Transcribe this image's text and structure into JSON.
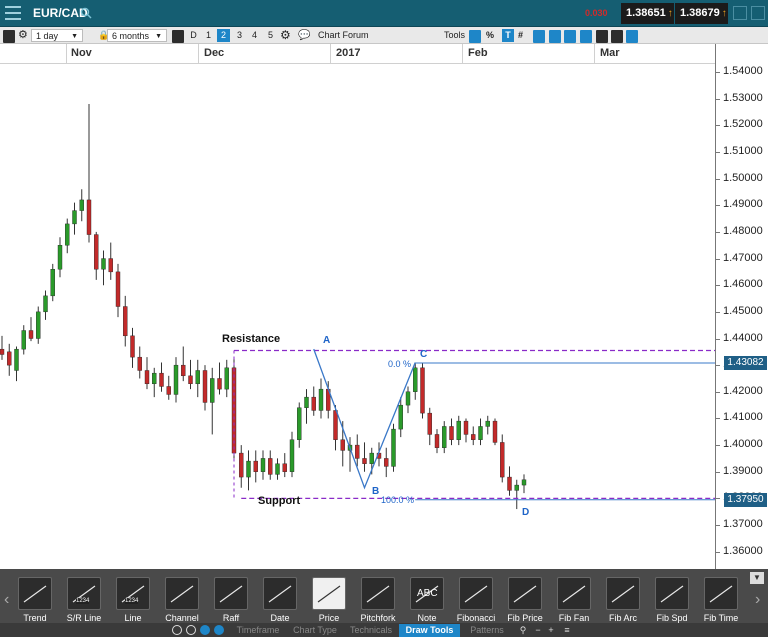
{
  "header": {
    "symbol": "EUR/CAD",
    "spread": "0.030",
    "bid": "1.38651",
    "ask": "1.38679",
    "bid_arrow": "↑",
    "ask_arrow": "↑"
  },
  "toolbar": {
    "interval": "1 day",
    "range": "6 months",
    "layouts": [
      "D",
      "1",
      "2",
      "3",
      "4",
      "5"
    ],
    "active_layout": "2",
    "chart_forum": "Chart Forum",
    "tools": "Tools",
    "percent": "%",
    "text_tool": "T"
  },
  "timeline": {
    "months": [
      "Nov",
      "Dec",
      "2017",
      "Feb",
      "Mar"
    ]
  },
  "yaxis": {
    "ticks": [
      "1.54000",
      "1.53000",
      "1.52000",
      "1.51000",
      "1.50000",
      "1.49000",
      "1.48000",
      "1.47000",
      "1.46000",
      "1.45000",
      "1.44000",
      "1.43000",
      "1.42000",
      "1.41000",
      "1.40000",
      "1.39000",
      "1.38000",
      "1.37000",
      "1.36000"
    ],
    "resistance_label": "1.43082",
    "support_label": "1.37950"
  },
  "annotations": {
    "resistance": "Resistance",
    "support": "Support",
    "points": [
      "A",
      "B",
      "C",
      "D"
    ],
    "fib_top": "0.0 %",
    "fib_bottom": "100.0 %"
  },
  "colors": {
    "bull": "#2a9a2a",
    "bear": "#c22a2a",
    "pattern_line": "#3a78c8",
    "level_line": "#8a2bc8",
    "header_bg": "#155e72",
    "accent": "#1e86c8"
  },
  "chart_data": {
    "type": "candlestick",
    "ylim": [
      1.355,
      1.545
    ],
    "ohlc": [
      [
        1.436,
        1.441,
        1.432,
        1.434
      ],
      [
        1.435,
        1.438,
        1.426,
        1.43
      ],
      [
        1.428,
        1.437,
        1.424,
        1.436
      ],
      [
        1.436,
        1.445,
        1.434,
        1.443
      ],
      [
        1.443,
        1.448,
        1.439,
        1.44
      ],
      [
        1.44,
        1.452,
        1.438,
        1.45
      ],
      [
        1.45,
        1.458,
        1.447,
        1.456
      ],
      [
        1.456,
        1.468,
        1.454,
        1.466
      ],
      [
        1.466,
        1.478,
        1.463,
        1.475
      ],
      [
        1.475,
        1.485,
        1.472,
        1.483
      ],
      [
        1.483,
        1.491,
        1.479,
        1.488
      ],
      [
        1.488,
        1.496,
        1.484,
        1.492
      ],
      [
        1.492,
        1.528,
        1.476,
        1.479
      ],
      [
        1.479,
        1.48,
        1.462,
        1.466
      ],
      [
        1.466,
        1.473,
        1.46,
        1.47
      ],
      [
        1.47,
        1.476,
        1.462,
        1.465
      ],
      [
        1.465,
        1.468,
        1.448,
        1.452
      ],
      [
        1.452,
        1.456,
        1.437,
        1.441
      ],
      [
        1.441,
        1.444,
        1.429,
        1.433
      ],
      [
        1.433,
        1.437,
        1.425,
        1.428
      ],
      [
        1.428,
        1.433,
        1.421,
        1.423
      ],
      [
        1.423,
        1.429,
        1.418,
        1.427
      ],
      [
        1.427,
        1.431,
        1.42,
        1.422
      ],
      [
        1.422,
        1.426,
        1.417,
        1.419
      ],
      [
        1.419,
        1.433,
        1.416,
        1.43
      ],
      [
        1.43,
        1.437,
        1.424,
        1.426
      ],
      [
        1.426,
        1.432,
        1.421,
        1.423
      ],
      [
        1.423,
        1.432,
        1.418,
        1.428
      ],
      [
        1.428,
        1.43,
        1.413,
        1.416
      ],
      [
        1.416,
        1.429,
        1.404,
        1.425
      ],
      [
        1.425,
        1.431,
        1.419,
        1.421
      ],
      [
        1.421,
        1.432,
        1.418,
        1.429
      ],
      [
        1.429,
        1.433,
        1.395,
        1.397
      ],
      [
        1.397,
        1.4,
        1.384,
        1.388
      ],
      [
        1.388,
        1.398,
        1.383,
        1.394
      ],
      [
        1.394,
        1.398,
        1.386,
        1.39
      ],
      [
        1.39,
        1.398,
        1.387,
        1.395
      ],
      [
        1.395,
        1.398,
        1.387,
        1.389
      ],
      [
        1.389,
        1.395,
        1.387,
        1.393
      ],
      [
        1.393,
        1.397,
        1.388,
        1.39
      ],
      [
        1.39,
        1.405,
        1.388,
        1.402
      ],
      [
        1.402,
        1.416,
        1.399,
        1.414
      ],
      [
        1.414,
        1.421,
        1.408,
        1.418
      ],
      [
        1.418,
        1.422,
        1.411,
        1.413
      ],
      [
        1.413,
        1.425,
        1.41,
        1.421
      ],
      [
        1.421,
        1.424,
        1.41,
        1.413
      ],
      [
        1.413,
        1.415,
        1.398,
        1.402
      ],
      [
        1.402,
        1.409,
        1.392,
        1.398
      ],
      [
        1.398,
        1.403,
        1.39,
        1.4
      ],
      [
        1.4,
        1.404,
        1.392,
        1.395
      ],
      [
        1.395,
        1.401,
        1.39,
        1.393
      ],
      [
        1.393,
        1.399,
        1.389,
        1.397
      ],
      [
        1.397,
        1.401,
        1.392,
        1.395
      ],
      [
        1.395,
        1.399,
        1.388,
        1.392
      ],
      [
        1.392,
        1.408,
        1.39,
        1.406
      ],
      [
        1.406,
        1.418,
        1.403,
        1.415
      ],
      [
        1.415,
        1.422,
        1.412,
        1.42
      ],
      [
        1.42,
        1.431,
        1.417,
        1.429
      ],
      [
        1.429,
        1.431,
        1.41,
        1.412
      ],
      [
        1.412,
        1.414,
        1.4,
        1.404
      ],
      [
        1.404,
        1.406,
        1.397,
        1.399
      ],
      [
        1.399,
        1.409,
        1.397,
        1.407
      ],
      [
        1.407,
        1.41,
        1.4,
        1.402
      ],
      [
        1.402,
        1.411,
        1.4,
        1.409
      ],
      [
        1.409,
        1.41,
        1.401,
        1.404
      ],
      [
        1.404,
        1.407,
        1.4,
        1.402
      ],
      [
        1.402,
        1.41,
        1.4,
        1.407
      ],
      [
        1.407,
        1.411,
        1.404,
        1.409
      ],
      [
        1.409,
        1.41,
        1.4,
        1.401
      ],
      [
        1.401,
        1.404,
        1.386,
        1.388
      ],
      [
        1.388,
        1.392,
        1.381,
        1.383
      ],
      [
        1.383,
        1.387,
        1.376,
        1.385
      ],
      [
        1.385,
        1.389,
        1.382,
        1.387
      ]
    ],
    "resistance_level": 1.4355,
    "support_level": 1.38,
    "fib_top_level": 1.4308,
    "fib_bottom_level": 1.3795,
    "pattern_points": [
      {
        "label": "A",
        "index": 43,
        "price": 1.436
      },
      {
        "label": "B",
        "index": 50,
        "price": 1.384
      },
      {
        "label": "C",
        "index": 57,
        "price": 1.431
      },
      {
        "label": "D",
        "index": 69,
        "price": 1.3795
      }
    ]
  },
  "draw_tools": [
    {
      "label": "Trend",
      "icon": "trend-line-icon",
      "light": false
    },
    {
      "label": "S/R Line",
      "icon": "sr-line-icon",
      "light": false
    },
    {
      "label": "Line",
      "icon": "line-icon",
      "light": false
    },
    {
      "label": "Channel",
      "icon": "channel-icon",
      "light": false
    },
    {
      "label": "Raff",
      "icon": "raff-icon",
      "light": false
    },
    {
      "label": "Date",
      "icon": "date-icon",
      "light": false
    },
    {
      "label": "Price",
      "icon": "price-icon",
      "light": true
    },
    {
      "label": "Pitchfork",
      "icon": "pitchfork-icon",
      "light": false
    },
    {
      "label": "Note",
      "icon": "note-icon",
      "light": false
    },
    {
      "label": "Fibonacci",
      "icon": "fibonacci-icon",
      "light": false
    },
    {
      "label": "Fib Price",
      "icon": "fib-price-icon",
      "light": false
    },
    {
      "label": "Fib Fan",
      "icon": "fib-fan-icon",
      "light": false
    },
    {
      "label": "Fib Arc",
      "icon": "fib-arc-icon",
      "light": false
    },
    {
      "label": "Fib Spd",
      "icon": "fib-spd-icon",
      "light": false
    },
    {
      "label": "Fib Time",
      "icon": "fib-time-icon",
      "light": false
    }
  ],
  "tool_inline_text": {
    "sr_line": "1234",
    "line": "1234",
    "note": "ABC"
  },
  "bottom_tabs": [
    "Timeframe",
    "Chart Type",
    "Technicals",
    "Draw Tools",
    "Patterns"
  ],
  "active_bottom_tab": "Draw Tools"
}
